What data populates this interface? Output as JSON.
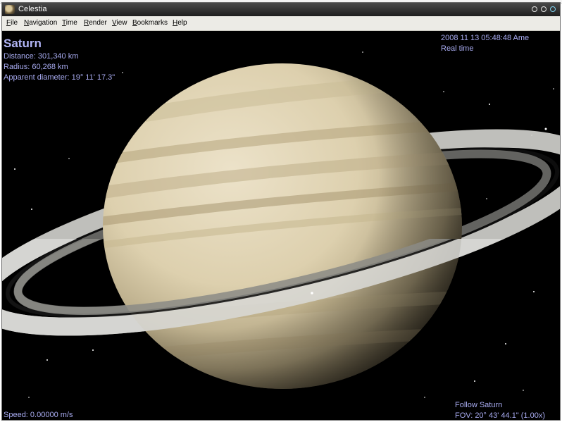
{
  "window": {
    "title": "Celestia",
    "app_icon": "celestia-app-icon"
  },
  "menu": [
    {
      "label": "File",
      "underline": "F"
    },
    {
      "label": "Navigation",
      "underline": "N"
    },
    {
      "label": "Time",
      "underline": "T"
    },
    {
      "label": "Render",
      "underline": "R"
    },
    {
      "label": "View",
      "underline": "V"
    },
    {
      "label": "Bookmarks",
      "underline": "B"
    },
    {
      "label": "Help",
      "underline": "H"
    }
  ],
  "hud": {
    "object_name": "Saturn",
    "distance": "Distance: 301,340 km",
    "radius": "Radius: 60,268 km",
    "apparent_diameter": "Apparent diameter: 19° 11' 17.3\"",
    "datetime": "2008 11 13 05:48:48 Ame",
    "time_mode": "Real time",
    "speed": "Speed: 0.00000 m/s",
    "follow": "Follow Saturn",
    "fov": "FOV: 20° 43' 44.1\" (1.00x)"
  },
  "colors": {
    "hud_text": "#a9acf2",
    "space": "#000000",
    "planet_light": "#e7dcc2",
    "planet_band": "#b9ab86",
    "ring": "#cfcfcd"
  }
}
